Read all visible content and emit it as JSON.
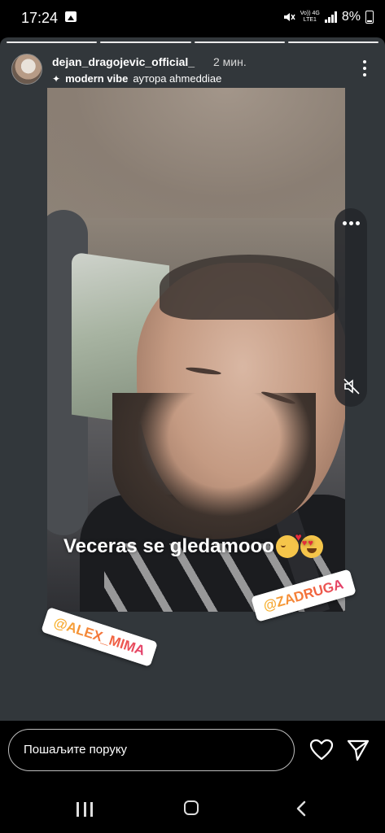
{
  "status_bar": {
    "time": "17:24",
    "network_top": "Vo)) 4G",
    "network_bottom": "LTE1",
    "battery": "8%"
  },
  "story": {
    "progress_segments": 4,
    "username": "dejan_dragojevic_official_",
    "time_ago": "2 мин.",
    "music_song": "modern vibe",
    "music_author": "аутора ahmeddiae",
    "caption": "Veceras se gledamooo",
    "caption_emojis": [
      "smiling-face-with-hearts",
      "heart-eyes"
    ],
    "mentions": [
      "@ALEX_MIMA",
      "@ZADRUGA"
    ]
  },
  "bottom_bar": {
    "message_placeholder": "Пошаљите поруку"
  },
  "icons": {
    "gallery": "image-icon",
    "mute_status": "mute-icon",
    "more": "more-vertical-icon",
    "side_more": "more-horizontal-icon",
    "side_mute": "speaker-muted-icon",
    "like": "heart-icon",
    "send": "send-icon"
  },
  "colors": {
    "background": "#000000",
    "story_bg": "#32373b",
    "mention_gradient_start": "#f7b733",
    "mention_gradient_end": "#e23d6d"
  }
}
